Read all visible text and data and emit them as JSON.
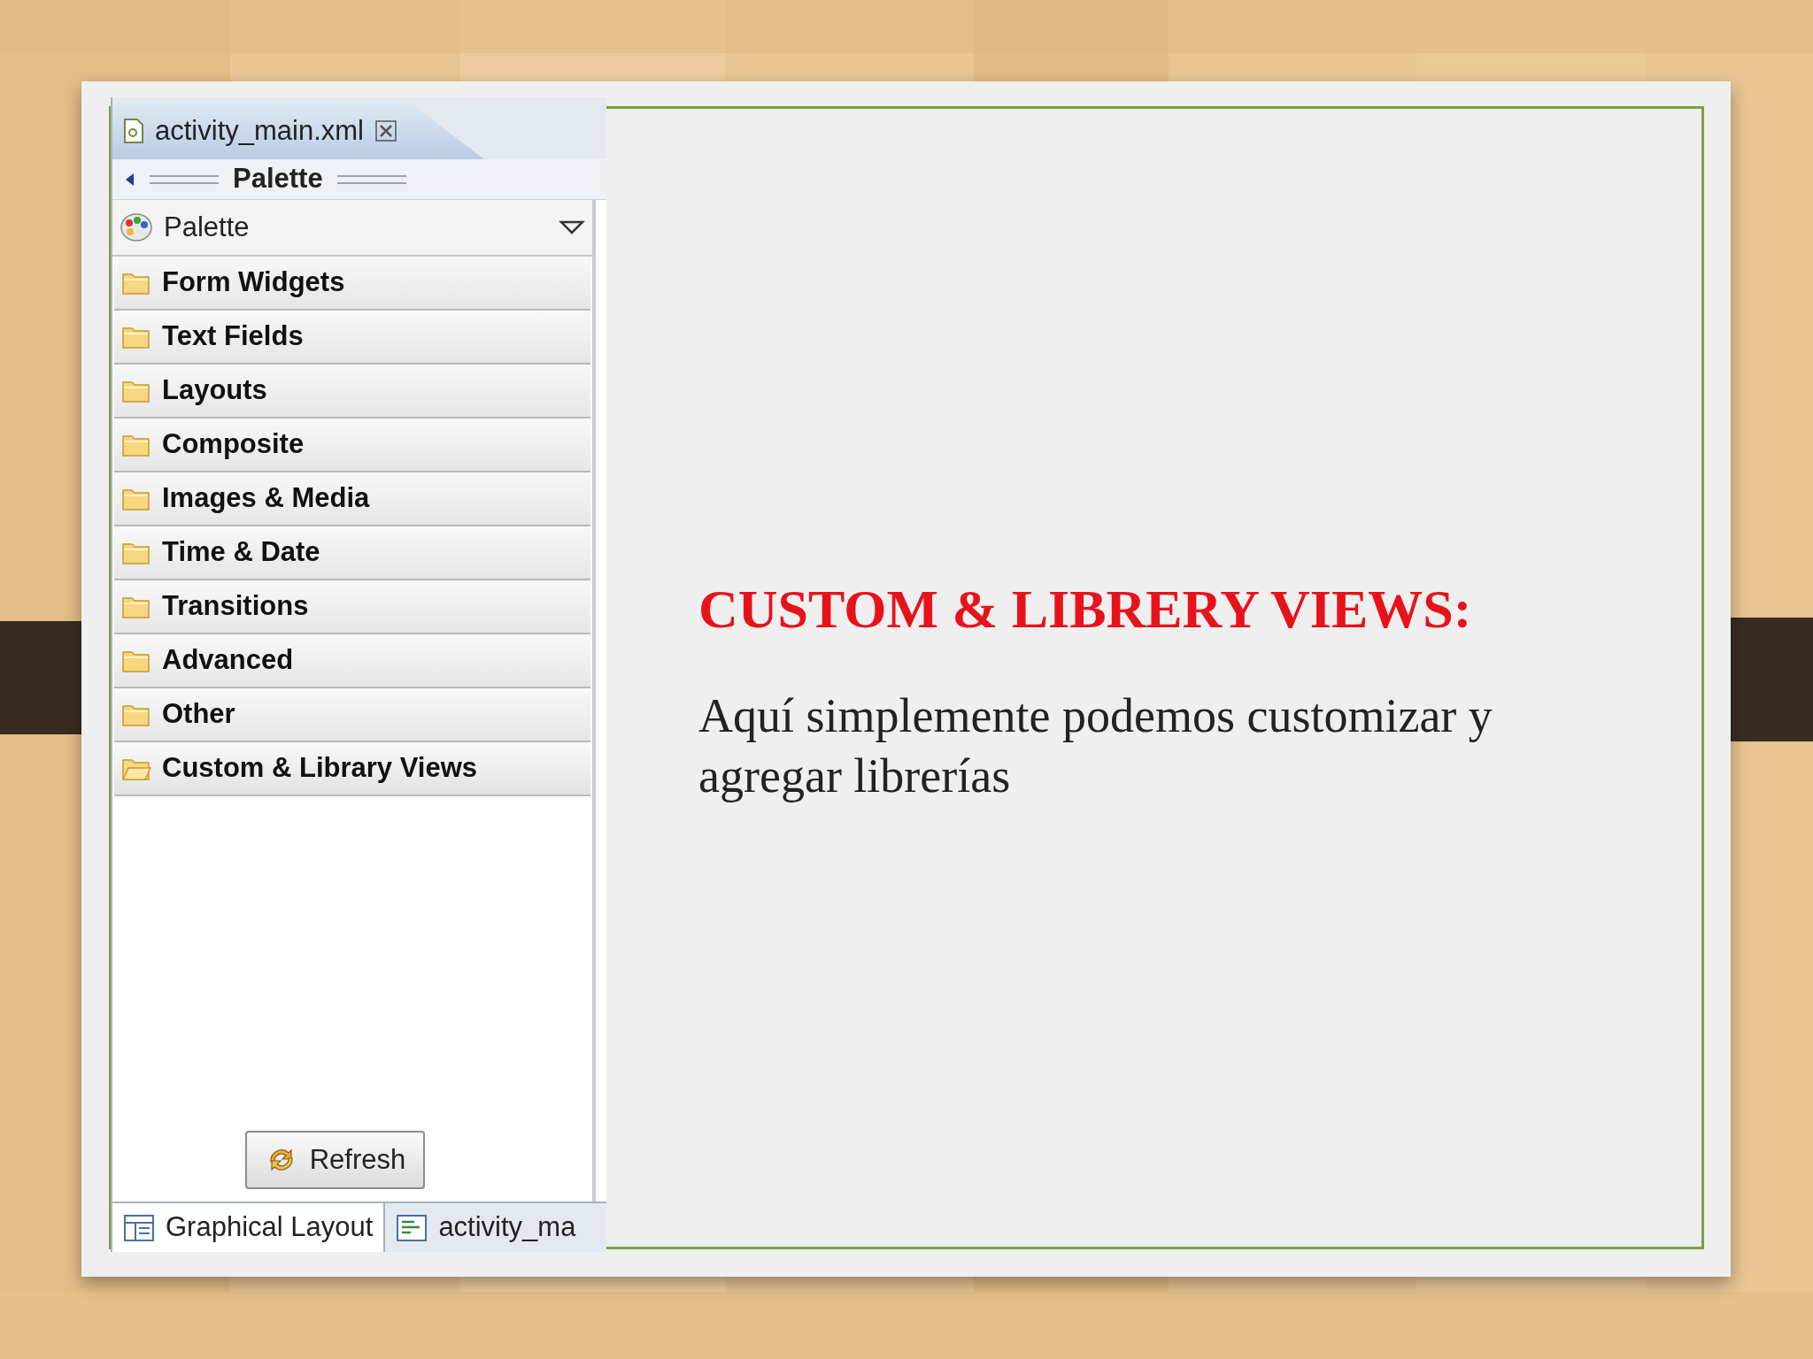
{
  "editor_tab": {
    "title": "activity_main.xml"
  },
  "palette_header": {
    "title": "Palette"
  },
  "palette_dropdown": {
    "label": "Palette"
  },
  "categories": [
    {
      "label": "Form Widgets",
      "expanded": false
    },
    {
      "label": "Text Fields",
      "expanded": false
    },
    {
      "label": "Layouts",
      "expanded": false
    },
    {
      "label": "Composite",
      "expanded": false
    },
    {
      "label": "Images & Media",
      "expanded": false
    },
    {
      "label": "Time & Date",
      "expanded": false
    },
    {
      "label": "Transitions",
      "expanded": false
    },
    {
      "label": "Advanced",
      "expanded": false
    },
    {
      "label": "Other",
      "expanded": false
    },
    {
      "label": "Custom & Library Views",
      "expanded": true
    }
  ],
  "refresh_button": {
    "label": "Refresh"
  },
  "bottom_tabs": [
    {
      "label": "Graphical Layout",
      "selected": true
    },
    {
      "label": "activity_ma",
      "selected": false
    }
  ],
  "slide": {
    "title": "CUSTOM & LIBRERY VIEWS:",
    "body": "Aquí simplemente podemos customizar y agregar librerías"
  }
}
